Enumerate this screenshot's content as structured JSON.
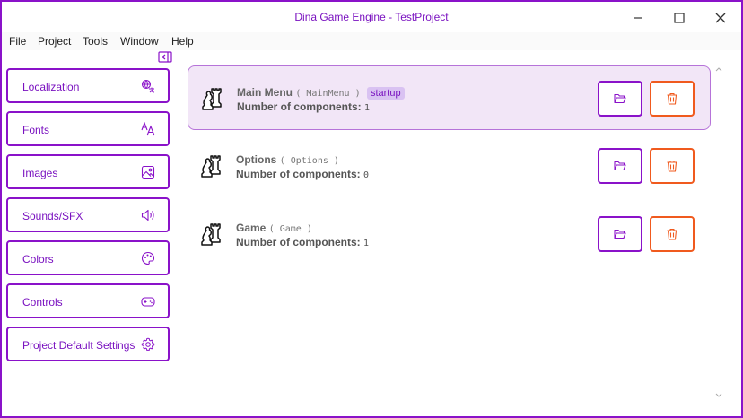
{
  "window": {
    "title": "Dina Game Engine - TestProject"
  },
  "menu": [
    "File",
    "Project",
    "Tools",
    "Window",
    "Help"
  ],
  "sidebar": {
    "items": [
      {
        "label": "Localization",
        "icon": "localization-icon"
      },
      {
        "label": "Fonts",
        "icon": "fonts-icon"
      },
      {
        "label": "Images",
        "icon": "image-icon"
      },
      {
        "label": "Sounds/SFX",
        "icon": "sound-icon"
      },
      {
        "label": "Colors",
        "icon": "palette-icon"
      },
      {
        "label": "Controls",
        "icon": "gamepad-icon"
      },
      {
        "label": "Project Default Settings",
        "icon": "gear-icon"
      }
    ]
  },
  "scenes": [
    {
      "name": "Main Menu",
      "id": "( MainMenu )",
      "badge": "startup",
      "components_label": "Number of components:",
      "count": "1"
    },
    {
      "name": "Options",
      "id": "( Options )",
      "badge": "",
      "components_label": "Number of components:",
      "count": "0"
    },
    {
      "name": "Game",
      "id": "( Game )",
      "badge": "",
      "components_label": "Number of components:",
      "count": "1"
    }
  ],
  "colors": {
    "accent": "#8a12c9",
    "delete": "#f05a1e",
    "active_bg": "#f2e6f7"
  }
}
